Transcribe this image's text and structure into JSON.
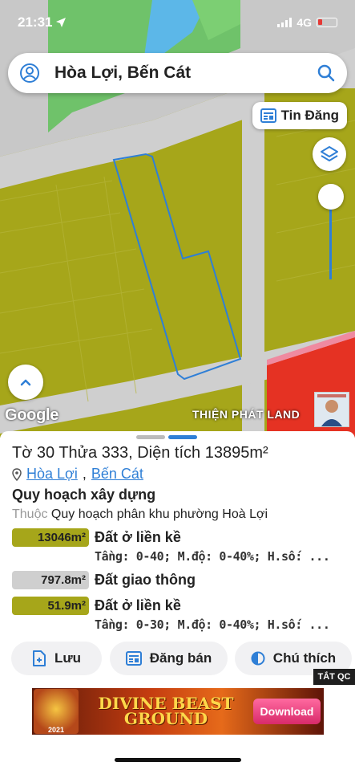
{
  "status_bar": {
    "time": "21:31",
    "network": "4G"
  },
  "search": {
    "title": "Hòa Lợi, Bến Cát"
  },
  "map_controls": {
    "listing_label": "Tin Đăng"
  },
  "map": {
    "attribution": "Google",
    "watermark": "THIỆN PHÁT LAND"
  },
  "parcel": {
    "title": "Tờ 30 Thửa 333, Diện tích 13895m²",
    "ward": "Hòa Lợi",
    "separator": ",",
    "district": "Bến Cát"
  },
  "planning": {
    "heading": "Quy hoạch xây dựng",
    "belongs_label": "Thuộc",
    "belongs_value": "Quy hoạch phân khu phường Hoà Lợi",
    "zones": [
      {
        "area": "13046m²",
        "name": "Đất ở liền kề",
        "info": "Tầng: 0-40; M.độ: 0-40%; H.số: ...",
        "color": "#a6a61a"
      },
      {
        "area": "797.8m²",
        "name": "Đất giao thông",
        "info": "",
        "color": "#cfcfcf"
      },
      {
        "area": "51.9m²",
        "name": "Đất ở liền kề",
        "info": "Tầng: 0-30; M.độ: 0-40%; H.số: ...",
        "color": "#a6a61a"
      }
    ]
  },
  "actions": {
    "save": "Lưu",
    "post_sale": "Đăng bán",
    "legend": "Chú thích"
  },
  "ads": {
    "close_label": "TẮT QC",
    "title_line1": "DIVINE BEAST",
    "title_line2": "GROUND",
    "cta": "Download",
    "logo_text": "2021"
  },
  "colors": {
    "accent": "#2f7fd6",
    "zone_residential": "#a6a61a",
    "zone_road": "#cfcfcf",
    "zone_commercial": "#e53223"
  }
}
